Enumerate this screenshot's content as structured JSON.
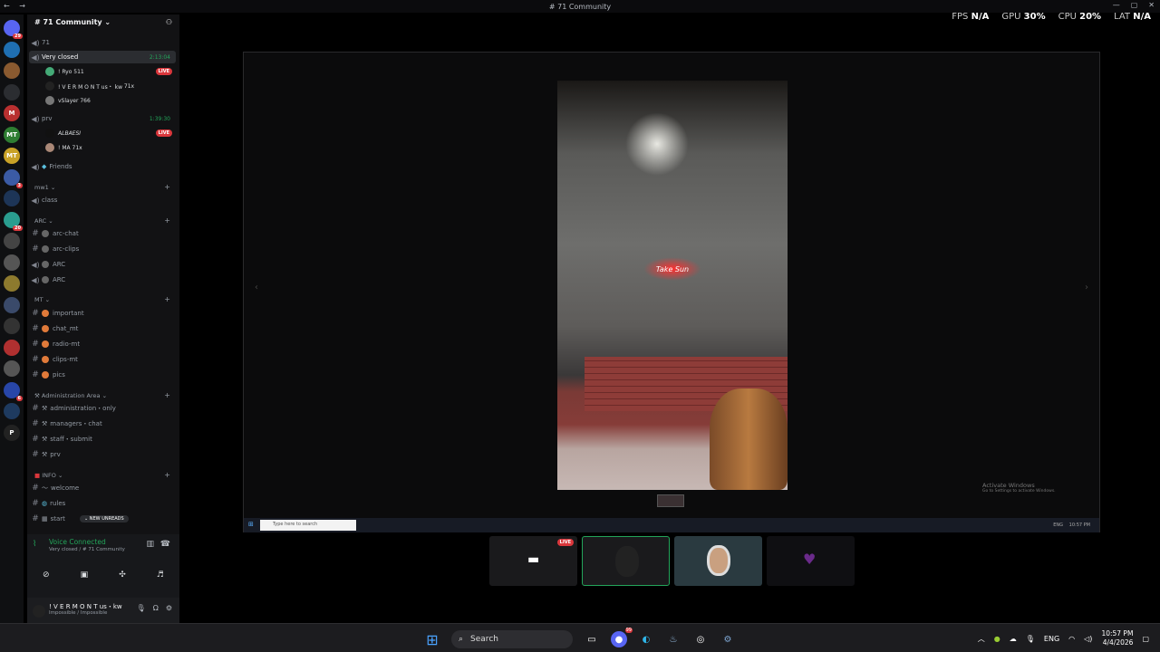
{
  "window": {
    "title": "# 71 Community",
    "nav": "← →"
  },
  "stats": {
    "fps_label": "FPS",
    "fps_value": "N/A",
    "gpu_label": "GPU",
    "gpu_value": "30%",
    "cpu_label": "CPU",
    "cpu_value": "20%",
    "lat_label": "LAT",
    "lat_value": "N/A"
  },
  "servers": [
    {
      "label": "",
      "badge": "29",
      "color": "#5865f2"
    },
    {
      "label": "",
      "badge": "",
      "color": "#1f6fb2"
    },
    {
      "label": "",
      "badge": "",
      "color": "#8a5a30"
    },
    {
      "label": "",
      "badge": "",
      "color": "#2b2d31"
    },
    {
      "label": "M",
      "badge": "",
      "color": "#b93030"
    },
    {
      "label": "MT",
      "badge": "",
      "color": "#2e7d32"
    },
    {
      "label": "MT",
      "badge": "",
      "color": "#c9a227"
    },
    {
      "label": "",
      "badge": "3",
      "color": "#3b5ba5"
    },
    {
      "label": "",
      "badge": "",
      "color": "#1d3557"
    },
    {
      "label": "",
      "badge": "20",
      "color": "#2a9d8f"
    },
    {
      "label": "",
      "badge": "",
      "color": "#444"
    },
    {
      "label": "",
      "badge": "",
      "color": "#555"
    },
    {
      "label": "",
      "badge": "",
      "color": "#8d7a2e"
    },
    {
      "label": "",
      "badge": "",
      "color": "#3a4a6a"
    },
    {
      "label": "",
      "badge": "",
      "color": "#333"
    },
    {
      "label": "",
      "badge": "",
      "color": "#b03030"
    },
    {
      "label": "",
      "badge": "",
      "color": "#555"
    },
    {
      "label": "",
      "badge": "6",
      "color": "#2846a8"
    },
    {
      "label": "",
      "badge": "",
      "color": "#1e3a5f"
    },
    {
      "label": "P",
      "badge": "",
      "color": "#222"
    }
  ],
  "sidebar": {
    "server_name": "# 71 Community",
    "ch_71": "71",
    "very_closed": "Very closed",
    "very_closed_time": "2:13:04",
    "u1": "! Ryo",
    "u1b": "511",
    "u2": "! V E R M O N T us・ kw",
    "u2b": "71x",
    "u3": "vSlayer",
    "u3b": "766",
    "prv": "prv",
    "prv_time": "1:39:30",
    "u4": "ALBAESI",
    "u5": "! MA",
    "u5b": "71x",
    "friends": "Friends",
    "cat_mw": "mw1",
    "class": "class",
    "cat_arc": "ARC",
    "arc_chat": "arc-chat",
    "arc_clips": "arc-clips",
    "arc_v1": "ARC",
    "arc_v2": "ARC",
    "cat_mt": "MT",
    "important": "important",
    "chat_mt": "chat_mt",
    "radio_mt": "radio-mt",
    "clips_mt": "clips-mt",
    "pics": "pics",
    "cat_admin": "Administration Area",
    "admin_only": "administration・only",
    "managers": "managers・chat",
    "staff": "staff・submit",
    "prv2": "prv",
    "cat_info": "INFO",
    "welcome": "welcome",
    "rules": "rules",
    "start": "start",
    "new_unreads": "NEW UNREADS",
    "live": "LIVE"
  },
  "voice": {
    "status": "Voice Connected",
    "channel": "Very closed / # 71 Community"
  },
  "user": {
    "name": "! V E R M O N T us・kw",
    "status": "Impossible / Impossible"
  },
  "stream": {
    "neon_text": "Take Sun",
    "activate_title": "Activate Windows",
    "activate_sub": "Go to Settings to activate Windows.",
    "inner_search": "Type here to search",
    "inner_tray": "ENG",
    "inner_time": "10:57 PM"
  },
  "tiles": {
    "live": "LIVE"
  },
  "taskbar": {
    "search": "Search",
    "lang": "ENG",
    "time": "10:57 PM",
    "date": "4/4/2026",
    "badge": "99"
  }
}
